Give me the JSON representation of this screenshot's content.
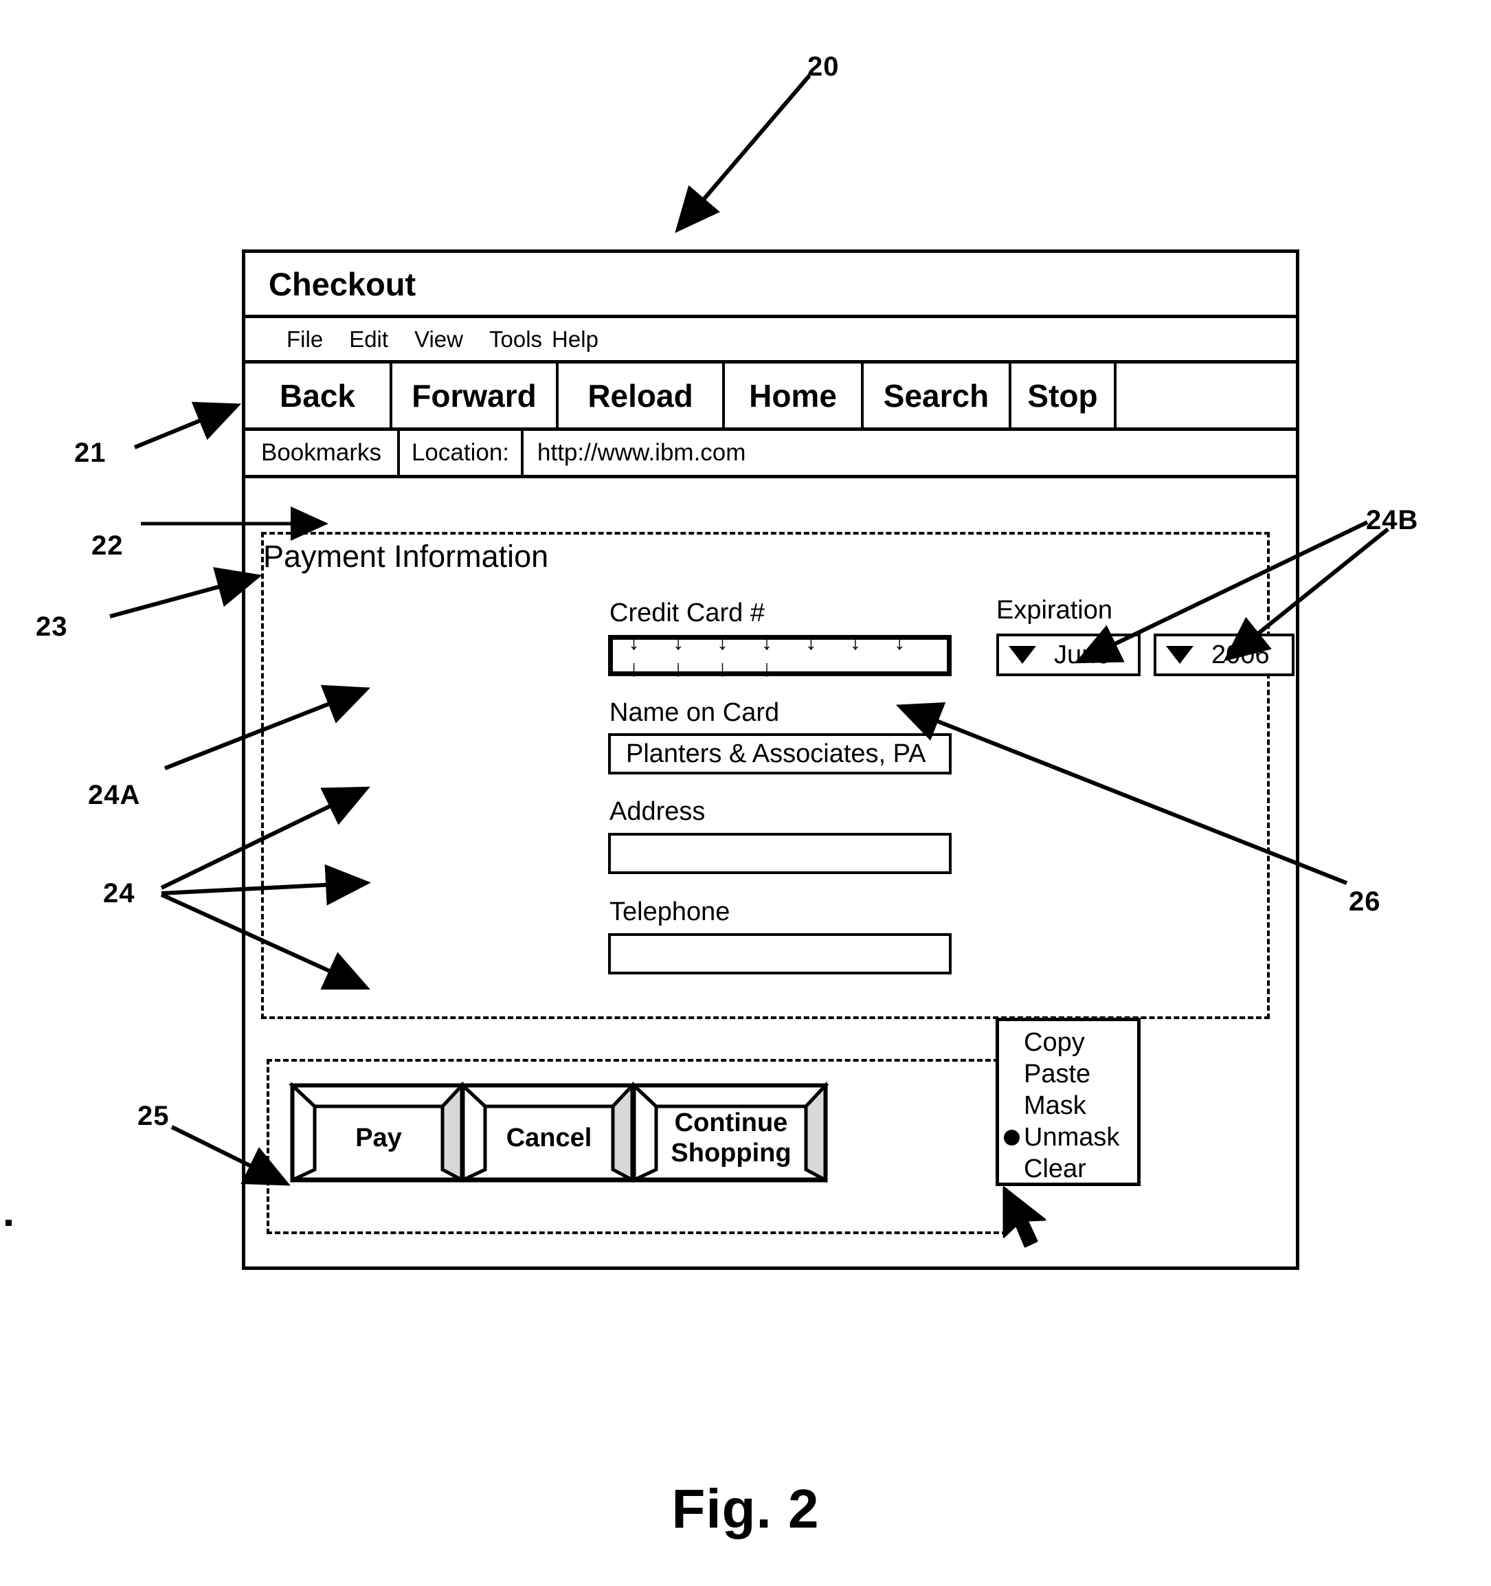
{
  "figure": {
    "caption": "Fig. 2",
    "ref_numerals": [
      {
        "id": "20",
        "label": "20"
      },
      {
        "id": "21",
        "label": "21"
      },
      {
        "id": "22",
        "label": "22"
      },
      {
        "id": "23",
        "label": "23"
      },
      {
        "id": "24",
        "label": "24"
      },
      {
        "id": "24A",
        "label": "24A"
      },
      {
        "id": "24B",
        "label": "24B"
      },
      {
        "id": "25",
        "label": "25"
      },
      {
        "id": "26",
        "label": "26"
      }
    ]
  },
  "browser": {
    "title": "Checkout",
    "menu": [
      {
        "label": "File"
      },
      {
        "label": "Edit"
      },
      {
        "label": "View"
      },
      {
        "label": "Tools"
      },
      {
        "label": "Help"
      }
    ],
    "toolbar": [
      {
        "label": "Back"
      },
      {
        "label": "Forward"
      },
      {
        "label": "Reload"
      },
      {
        "label": "Home"
      },
      {
        "label": "Search"
      },
      {
        "label": "Stop"
      }
    ],
    "location_bar": {
      "bookmarks_label": "Bookmarks",
      "location_label": "Location:",
      "url": "http://www.ibm.com"
    }
  },
  "page": {
    "payment_section": {
      "title": "Payment Information",
      "fields": {
        "credit_card": {
          "label": "Credit Card #",
          "value": "↓ ↓ ↓ ↓ ↓ ↓ ↓ ↓ ↓ ↓ ↓"
        },
        "name_on_card": {
          "label": "Name on Card",
          "value": "Planters & Associates, PA"
        },
        "address": {
          "label": "Address",
          "value": ""
        },
        "telephone": {
          "label": "Telephone",
          "value": ""
        }
      },
      "expiration": {
        "label": "Expiration",
        "month_value": "June",
        "year_value": "2006"
      }
    },
    "context_menu": {
      "items": [
        {
          "label": "Copy",
          "selected": false
        },
        {
          "label": "Paste",
          "selected": false
        },
        {
          "label": "Mask",
          "selected": false
        },
        {
          "label": "Unmask",
          "selected": true
        },
        {
          "label": "Clear",
          "selected": false
        }
      ]
    },
    "action_buttons": [
      {
        "label": "Pay"
      },
      {
        "label": "Cancel"
      },
      {
        "label": "Continue Shopping"
      }
    ]
  }
}
